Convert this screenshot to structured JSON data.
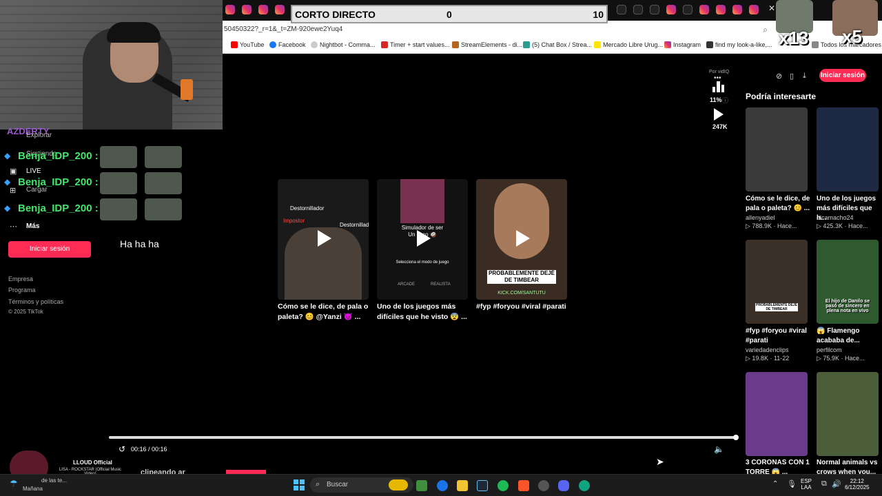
{
  "overlay": {
    "scoreboard": {
      "title": "CORTO DIRECTO",
      "left_score": "0",
      "right_score": "10"
    },
    "emotes": [
      {
        "label": "x13"
      },
      {
        "label": "x5"
      }
    ]
  },
  "browser": {
    "address": "50450322?_r=1&_t=ZM-920ewe2Yuq4",
    "bookmarks": [
      {
        "label": "YouTube",
        "icon": "youtube-icon",
        "color": "#ff0000"
      },
      {
        "label": "Facebook",
        "icon": "facebook-icon",
        "color": "#1877f2"
      },
      {
        "label": "Nightbot - Comma...",
        "icon": "nightbot-icon",
        "color": "#cccccc"
      },
      {
        "label": "Timer + start values...",
        "icon": "dps-icon",
        "color": "#d62828"
      },
      {
        "label": "StreamElements - di...",
        "icon": "streamelements-icon",
        "color": "#b5651d"
      },
      {
        "label": "(5) Chat Box / Strea...",
        "icon": "chat-icon",
        "color": "#2a9d8f"
      },
      {
        "label": "Mercado Libre Urug...",
        "icon": "mercadolibre-icon",
        "color": "#ffe600"
      },
      {
        "label": "Instagram",
        "icon": "instagram-icon",
        "color": "#e1306c"
      },
      {
        "label": "find my look-a-like,...",
        "icon": "flag-icon",
        "color": "#333333"
      },
      {
        "label": "Todos los marcadores",
        "icon": "folder-icon",
        "color": "#888888"
      }
    ]
  },
  "sidebar": {
    "items": [
      {
        "label": "Explorar"
      },
      {
        "label": "Siguiendo"
      },
      {
        "label": "LIVE"
      },
      {
        "label": "Cargar"
      },
      {
        "label": "Más"
      }
    ],
    "login": "Iniciar sesión",
    "footer": [
      "Empresa",
      "Programa",
      "Términos y políticas",
      "© 2025 TikTok"
    ],
    "overlay_text": "AZDERTY"
  },
  "chat": {
    "lines": [
      {
        "name": "Benja_IDP_200 :"
      },
      {
        "name": "Benja_IDP_200 :"
      },
      {
        "name": "Benja_IDP_200 :"
      }
    ],
    "message": "Ha ha ha"
  },
  "videos": [
    {
      "caption": "Cómo se le dice, de pala o paleta? 😊 @Yanzi 😈 ...",
      "labels": [
        "Destornillador",
        "Impostor",
        "Destornillador"
      ]
    },
    {
      "caption": "Uno de los juegos más difíciles que he visto 😨 ...",
      "labels": [
        "Simulador de ser",
        "Un coco 🥥",
        "Selecciona el modo de juego",
        "ARCADE",
        "REALISTA"
      ]
    },
    {
      "caption": "#fyp #foryou #viral #parati",
      "labels": [
        "PROBABLEMENTE DEJÉ DE TIMBEAR",
        "KICK.COM/SANTUTU"
      ]
    }
  ],
  "player": {
    "vidiq": "Por vidIQ",
    "percent": "11%",
    "views": "247K",
    "time": "00:16 / 00:16",
    "progress": 1.0
  },
  "right_panel": {
    "title": "Podría interesarte",
    "login": "Iniciar sesión",
    "cards": [
      {
        "title": "Cómo se le dice, de pala o paleta? 😊 ...",
        "author": "allenyadiel",
        "stats": "▷ 788.9K · Hace...",
        "thumb": "#3a3a3a"
      },
      {
        "title": "Uno de los juegos más difíciles que h...",
        "author": "elcamacho24",
        "stats": "▷ 425.3K · Hace...",
        "thumb": "#1e2a44"
      },
      {
        "title": "#fyp #foryou #viral #parati",
        "author": "variedadenclips",
        "stats": "▷ 19.8K · 11-22",
        "thumb": "#3b3028"
      },
      {
        "title": "😱 Flamengo acababa de...",
        "author": "perfilcom",
        "stats": "▷ 75.9K · Hace...",
        "thumb": "#2f5a2f"
      },
      {
        "title": "3 CORONAS CON 1 TORRE 😱 ...",
        "author": "",
        "stats": "",
        "thumb": "#6a3b8a"
      },
      {
        "title": "Normal animals vs crows when you...",
        "author": "",
        "stats": "",
        "thumb": "#4c5d3a"
      }
    ],
    "card_labels": [
      "PROBABLEMENTE DEJÉ DE TIMBEAR",
      "El hijo de Danilo se pasó de sincero en plena nota en vivo"
    ]
  },
  "below_player": {
    "partial": "clipeando ar"
  },
  "music": {
    "artist": "LLOUD Official",
    "track": "LISA - ROCKSTAR (Official Music Video)"
  },
  "weather": {
    "label": "Mañana",
    "sub": "de las te..."
  },
  "taskbar": {
    "search": "Buscar",
    "lang": "ESP",
    "lang_sub": "LAA",
    "time": "22:12",
    "date": "6/12/2025"
  }
}
